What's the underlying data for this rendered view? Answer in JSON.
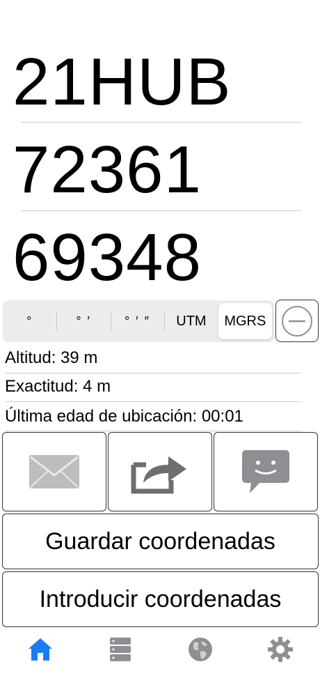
{
  "coordinates": {
    "zone": "21HUB",
    "easting": "72361",
    "northing": "69348"
  },
  "format_selector": {
    "options": [
      "°",
      "° ′",
      "° ′ ″",
      "UTM",
      "MGRS"
    ],
    "selected": "MGRS"
  },
  "info": {
    "altitude": "Altitud: 39 m",
    "accuracy": "Exactitud: 4 m",
    "location_age": "Última edad de ubicación: 00:01"
  },
  "actions": {
    "save_label": "Guardar coordenadas",
    "enter_label": "Introducir coordenadas"
  },
  "tabbar": {
    "active": "home",
    "items": [
      "home-icon",
      "list-icon",
      "globe-icon",
      "settings-icon"
    ]
  },
  "colors": {
    "accent": "#1a7cf0",
    "icon_gray": "#8e8e93",
    "share_gray": "#6e6e6e"
  }
}
